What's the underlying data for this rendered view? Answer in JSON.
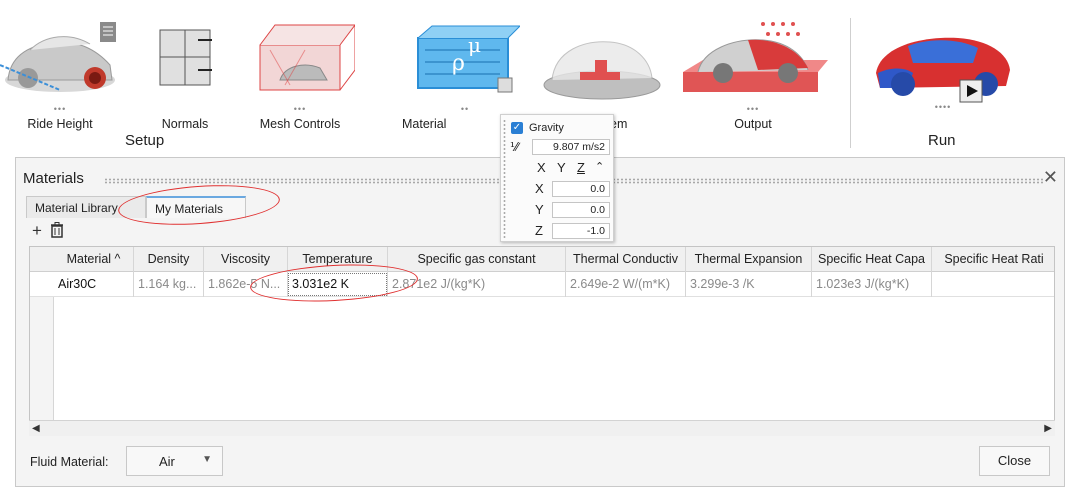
{
  "ribbon": {
    "tools": [
      {
        "id": "ride-height",
        "label": "Ride Height"
      },
      {
        "id": "normals",
        "label": "Normals"
      },
      {
        "id": "mesh-controls",
        "label": "Mesh Controls"
      },
      {
        "id": "material",
        "label": "Material"
      },
      {
        "id": "system",
        "label": "em"
      },
      {
        "id": "output",
        "label": "Output"
      },
      {
        "id": "run",
        "label": ""
      }
    ],
    "groups": {
      "setup": "Setup",
      "run": "Run"
    }
  },
  "dialog": {
    "title": "Materials",
    "tabs": [
      "Material Library",
      "My Materials"
    ],
    "active_tab": "My Materials",
    "columns": [
      "Material ^",
      "Density",
      "Viscosity",
      "Temperature",
      "Specific gas constant",
      "Thermal Conductiv",
      "Thermal Expansion",
      "Specific Heat Capa",
      "Specific Heat Rati"
    ],
    "rows": [
      [
        "Air30C",
        "1.164 kg...",
        "1.862e-5 N...",
        "3.031e2 K",
        "2.871e2 J/(kg*K)",
        "2.649e-2 W/(m*K)",
        "3.299e-3 /K",
        "1.023e3 J/(kg*K)",
        ""
      ]
    ],
    "fluid_material_label": "Fluid Material:",
    "fluid_material_value": "Air",
    "close_label": "Close",
    "close_x": "✕"
  },
  "gravity": {
    "label": "Gravity",
    "checked": true,
    "magnitude": "9.807 m/s2",
    "axes_header": [
      "X",
      "Y",
      "Z"
    ],
    "x": "0.0",
    "y": "0.0",
    "z": "-1.0"
  },
  "colors": {
    "accent": "#2a7fd4",
    "annotation": "#e03030",
    "tab_accent": "#6aa8e0"
  }
}
